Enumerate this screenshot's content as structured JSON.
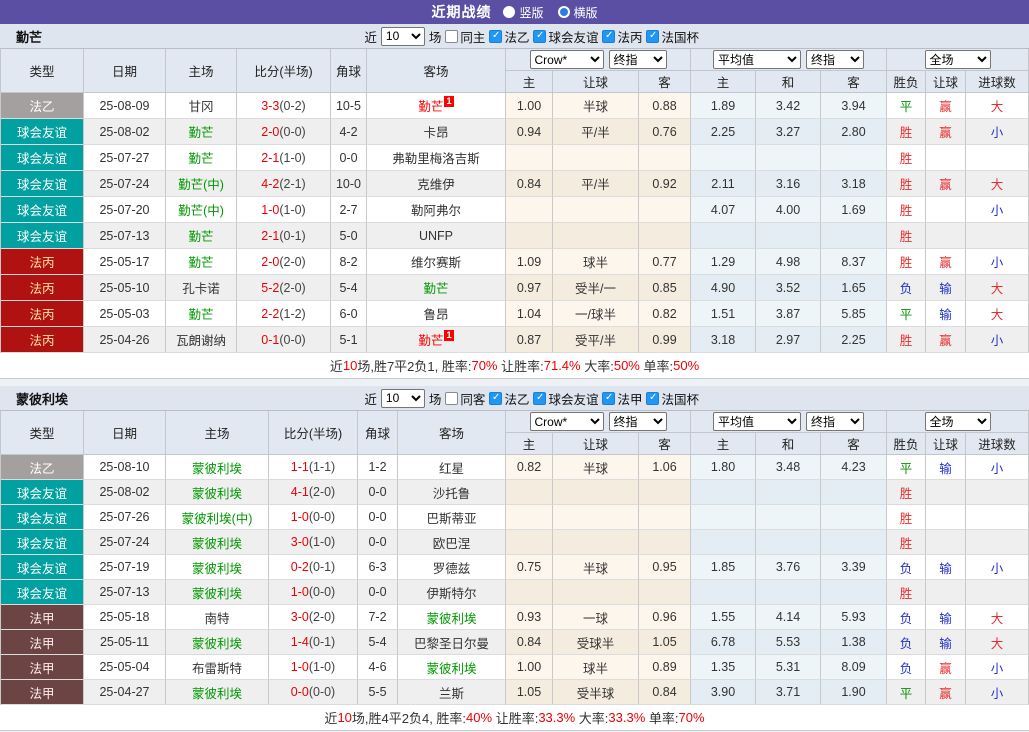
{
  "topbar": {
    "title": "近期战绩",
    "radios": [
      {
        "label": "竖版",
        "checked": false
      },
      {
        "label": "横版",
        "checked": true
      }
    ]
  },
  "left_headers": [
    "类型",
    "日期",
    "主场",
    "比分(半场)",
    "角球",
    "客场"
  ],
  "header_labels": [
    "主",
    "让球",
    "客",
    "主",
    "和",
    "客",
    "胜负",
    "让球",
    "进球数"
  ],
  "dropdowns": {
    "asia": [
      "Crow*",
      "终指"
    ],
    "euro": [
      "平均值",
      "终指"
    ],
    "result": [
      "全场"
    ]
  },
  "colors": {
    "topbar_bg": "#5a4fa2",
    "checkbox_blue": "#2196f3",
    "team_green": "#009900",
    "team_red": "#ff0000",
    "score_red": "#ee0000",
    "win_red": "#e62e2e",
    "lose_blue": "#2330c8",
    "draw_green": "#089000",
    "leagues": {
      "法乙": {
        "bg": "#a5a0a0",
        "fg": "#ffffff"
      },
      "球会友谊": {
        "bg": "#01a1a1",
        "fg": "#ffffff"
      },
      "法丙": {
        "bg": "#b01111",
        "fg": "#ffe3a8"
      },
      "法甲": {
        "bg": "#6d4444",
        "fg": "#ffecec"
      }
    }
  },
  "tables": [
    {
      "team": "勤芒",
      "filter": {
        "prefix": "近",
        "count": "10",
        "suffix": "场",
        "same": {
          "label": "同主",
          "checked": false
        },
        "leagues": [
          {
            "label": "法乙",
            "checked": true
          },
          {
            "label": "球会友谊",
            "checked": true
          },
          {
            "label": "法丙",
            "checked": true
          },
          {
            "label": "法国杯",
            "checked": true
          }
        ]
      },
      "rows": [
        {
          "league": "法乙",
          "date": "25-08-09",
          "home": "甘冈",
          "home_style": "normal",
          "score": "3-3",
          "half": "(0-2)",
          "corner": "10-5",
          "away": "勤芒",
          "away_style": "red",
          "away_badge": "1",
          "asia": [
            "1.00",
            "半球",
            "0.88"
          ],
          "euro": [
            "1.89",
            "3.42",
            "3.94"
          ],
          "result": [
            "平",
            "green"
          ],
          "handicap": [
            "赢",
            "red"
          ],
          "goals": [
            "大",
            "red"
          ]
        },
        {
          "league": "球会友谊",
          "date": "25-08-02",
          "home": "勤芒",
          "home_style": "green",
          "score": "2-0",
          "half": "(0-0)",
          "corner": "4-2",
          "away": "卡昂",
          "away_style": "normal",
          "asia": [
            "0.94",
            "平/半",
            "0.76"
          ],
          "euro": [
            "2.25",
            "3.27",
            "2.80"
          ],
          "result": [
            "胜",
            "red"
          ],
          "handicap": [
            "赢",
            "red"
          ],
          "goals": [
            "小",
            "blue"
          ]
        },
        {
          "league": "球会友谊",
          "date": "25-07-27",
          "home": "勤芒",
          "home_style": "green",
          "score": "2-1",
          "half": "(1-0)",
          "corner": "0-0",
          "away": "弗勒里梅洛吉斯",
          "away_style": "normal",
          "asia": [
            "",
            "",
            ""
          ],
          "euro": [
            "",
            "",
            ""
          ],
          "result": [
            "胜",
            "red"
          ],
          "handicap": [
            "",
            ""
          ],
          "goals": [
            "",
            ""
          ]
        },
        {
          "league": "球会友谊",
          "date": "25-07-24",
          "home": "勤芒(中)",
          "home_style": "green",
          "score": "4-2",
          "half": "(2-1)",
          "corner": "10-0",
          "away": "克维伊",
          "away_style": "normal",
          "asia": [
            "0.84",
            "平/半",
            "0.92"
          ],
          "euro": [
            "2.11",
            "3.16",
            "3.18"
          ],
          "result": [
            "胜",
            "red"
          ],
          "handicap": [
            "赢",
            "red"
          ],
          "goals": [
            "大",
            "red"
          ]
        },
        {
          "league": "球会友谊",
          "date": "25-07-20",
          "home": "勤芒(中)",
          "home_style": "green",
          "score": "1-0",
          "half": "(1-0)",
          "corner": "2-7",
          "away": "勒阿弗尔",
          "away_style": "normal",
          "asia": [
            "",
            "",
            ""
          ],
          "euro": [
            "4.07",
            "4.00",
            "1.69"
          ],
          "result": [
            "胜",
            "red"
          ],
          "handicap": [
            "",
            ""
          ],
          "goals": [
            "小",
            "blue"
          ]
        },
        {
          "league": "球会友谊",
          "date": "25-07-13",
          "home": "勤芒",
          "home_style": "green",
          "score": "2-1",
          "half": "(0-1)",
          "corner": "5-0",
          "away": "UNFP",
          "away_style": "normal",
          "asia": [
            "",
            "",
            ""
          ],
          "euro": [
            "",
            "",
            ""
          ],
          "result": [
            "胜",
            "red"
          ],
          "handicap": [
            "",
            ""
          ],
          "goals": [
            "",
            ""
          ]
        },
        {
          "league": "法丙",
          "date": "25-05-17",
          "home": "勤芒",
          "home_style": "green",
          "score": "2-0",
          "half": "(2-0)",
          "corner": "8-2",
          "away": "维尔赛斯",
          "away_style": "normal",
          "asia": [
            "1.09",
            "球半",
            "0.77"
          ],
          "euro": [
            "1.29",
            "4.98",
            "8.37"
          ],
          "result": [
            "胜",
            "red"
          ],
          "handicap": [
            "赢",
            "red"
          ],
          "goals": [
            "小",
            "blue"
          ]
        },
        {
          "league": "法丙",
          "date": "25-05-10",
          "home": "孔卡诺",
          "home_style": "normal",
          "score": "5-2",
          "half": "(2-0)",
          "corner": "5-4",
          "away": "勤芒",
          "away_style": "green",
          "asia": [
            "0.97",
            "受半/一",
            "0.85"
          ],
          "euro": [
            "4.90",
            "3.52",
            "1.65"
          ],
          "result": [
            "负",
            "blue"
          ],
          "handicap": [
            "输",
            "blue"
          ],
          "goals": [
            "大",
            "red"
          ]
        },
        {
          "league": "法丙",
          "date": "25-05-03",
          "home": "勤芒",
          "home_style": "green",
          "score": "2-2",
          "half": "(1-2)",
          "corner": "6-0",
          "away": "鲁昂",
          "away_style": "normal",
          "asia": [
            "1.04",
            "一/球半",
            "0.82"
          ],
          "euro": [
            "1.51",
            "3.87",
            "5.85"
          ],
          "result": [
            "平",
            "green"
          ],
          "handicap": [
            "输",
            "blue"
          ],
          "goals": [
            "大",
            "red"
          ]
        },
        {
          "league": "法丙",
          "date": "25-04-26",
          "home": "瓦朗谢纳",
          "home_style": "normal",
          "score": "0-1",
          "half": "(0-0)",
          "corner": "5-1",
          "away": "勤芒",
          "away_style": "red",
          "away_badge": "1",
          "asia": [
            "0.87",
            "受平/半",
            "0.99"
          ],
          "euro": [
            "3.18",
            "2.97",
            "2.25"
          ],
          "result": [
            "胜",
            "red"
          ],
          "handicap": [
            "赢",
            "red"
          ],
          "goals": [
            "小",
            "blue"
          ]
        }
      ],
      "summary": [
        {
          "text": "近"
        },
        {
          "text": "10",
          "red": true
        },
        {
          "text": "场,胜7平2负1, 胜率:"
        },
        {
          "text": "70%",
          "red": true
        },
        {
          "text": " 让胜率:"
        },
        {
          "text": "71.4%",
          "red": true
        },
        {
          "text": " 大率:"
        },
        {
          "text": "50%",
          "red": true
        },
        {
          "text": " 单率:"
        },
        {
          "text": "50%",
          "red": true
        }
      ]
    },
    {
      "team": "蒙彼利埃",
      "filter": {
        "prefix": "近",
        "count": "10",
        "suffix": "场",
        "same": {
          "label": "同客",
          "checked": false
        },
        "leagues": [
          {
            "label": "法乙",
            "checked": true
          },
          {
            "label": "球会友谊",
            "checked": true
          },
          {
            "label": "法甲",
            "checked": true
          },
          {
            "label": "法国杯",
            "checked": true
          }
        ]
      },
      "rows": [
        {
          "league": "法乙",
          "date": "25-08-10",
          "home": "蒙彼利埃",
          "home_style": "green",
          "score": "1-1",
          "half": "(1-1)",
          "corner": "1-2",
          "away": "红星",
          "away_style": "normal",
          "asia": [
            "0.82",
            "半球",
            "1.06"
          ],
          "euro": [
            "1.80",
            "3.48",
            "4.23"
          ],
          "result": [
            "平",
            "green"
          ],
          "handicap": [
            "输",
            "blue"
          ],
          "goals": [
            "小",
            "blue"
          ]
        },
        {
          "league": "球会友谊",
          "date": "25-08-02",
          "home": "蒙彼利埃",
          "home_style": "green",
          "score": "4-1",
          "half": "(2-0)",
          "corner": "0-0",
          "away": "沙托鲁",
          "away_style": "normal",
          "asia": [
            "",
            "",
            ""
          ],
          "euro": [
            "",
            "",
            ""
          ],
          "result": [
            "胜",
            "red"
          ],
          "handicap": [
            "",
            ""
          ],
          "goals": [
            "",
            ""
          ]
        },
        {
          "league": "球会友谊",
          "date": "25-07-26",
          "home": "蒙彼利埃(中)",
          "home_style": "green",
          "score": "1-0",
          "half": "(0-0)",
          "corner": "0-0",
          "away": "巴斯蒂亚",
          "away_style": "normal",
          "asia": [
            "",
            "",
            ""
          ],
          "euro": [
            "",
            "",
            ""
          ],
          "result": [
            "胜",
            "red"
          ],
          "handicap": [
            "",
            ""
          ],
          "goals": [
            "",
            ""
          ]
        },
        {
          "league": "球会友谊",
          "date": "25-07-24",
          "home": "蒙彼利埃",
          "home_style": "green",
          "score": "3-0",
          "half": "(1-0)",
          "corner": "0-0",
          "away": "欧巴涅",
          "away_style": "normal",
          "asia": [
            "",
            "",
            ""
          ],
          "euro": [
            "",
            "",
            ""
          ],
          "result": [
            "胜",
            "red"
          ],
          "handicap": [
            "",
            ""
          ],
          "goals": [
            "",
            ""
          ]
        },
        {
          "league": "球会友谊",
          "date": "25-07-19",
          "home": "蒙彼利埃",
          "home_style": "green",
          "score": "0-2",
          "half": "(0-1)",
          "corner": "6-3",
          "away": "罗德兹",
          "away_style": "normal",
          "asia": [
            "0.75",
            "半球",
            "0.95"
          ],
          "euro": [
            "1.85",
            "3.76",
            "3.39"
          ],
          "result": [
            "负",
            "blue"
          ],
          "handicap": [
            "输",
            "blue"
          ],
          "goals": [
            "小",
            "blue"
          ]
        },
        {
          "league": "球会友谊",
          "date": "25-07-13",
          "home": "蒙彼利埃",
          "home_style": "green",
          "score": "1-0",
          "half": "(0-0)",
          "corner": "0-0",
          "away": "伊斯特尔",
          "away_style": "normal",
          "asia": [
            "",
            "",
            ""
          ],
          "euro": [
            "",
            "",
            ""
          ],
          "result": [
            "胜",
            "red"
          ],
          "handicap": [
            "",
            ""
          ],
          "goals": [
            "",
            ""
          ]
        },
        {
          "league": "法甲",
          "date": "25-05-18",
          "home": "南特",
          "home_style": "normal",
          "score": "3-0",
          "half": "(2-0)",
          "corner": "7-2",
          "away": "蒙彼利埃",
          "away_style": "green",
          "asia": [
            "0.93",
            "一球",
            "0.96"
          ],
          "euro": [
            "1.55",
            "4.14",
            "5.93"
          ],
          "result": [
            "负",
            "blue"
          ],
          "handicap": [
            "输",
            "blue"
          ],
          "goals": [
            "大",
            "red"
          ]
        },
        {
          "league": "法甲",
          "date": "25-05-11",
          "home": "蒙彼利埃",
          "home_style": "green",
          "score": "1-4",
          "half": "(0-1)",
          "corner": "5-4",
          "away": "巴黎圣日尔曼",
          "away_style": "normal",
          "asia": [
            "0.84",
            "受球半",
            "1.05"
          ],
          "euro": [
            "6.78",
            "5.53",
            "1.38"
          ],
          "result": [
            "负",
            "blue"
          ],
          "handicap": [
            "输",
            "blue"
          ],
          "goals": [
            "大",
            "red"
          ]
        },
        {
          "league": "法甲",
          "date": "25-05-04",
          "home": "布雷斯特",
          "home_style": "normal",
          "score": "1-0",
          "half": "(1-0)",
          "corner": "4-6",
          "away": "蒙彼利埃",
          "away_style": "green",
          "asia": [
            "1.00",
            "球半",
            "0.89"
          ],
          "euro": [
            "1.35",
            "5.31",
            "8.09"
          ],
          "result": [
            "负",
            "blue"
          ],
          "handicap": [
            "赢",
            "red"
          ],
          "goals": [
            "小",
            "blue"
          ]
        },
        {
          "league": "法甲",
          "date": "25-04-27",
          "home": "蒙彼利埃",
          "home_style": "green",
          "score": "0-0",
          "half": "(0-0)",
          "corner": "5-5",
          "away": "兰斯",
          "away_style": "normal",
          "asia": [
            "1.05",
            "受半球",
            "0.84"
          ],
          "euro": [
            "3.90",
            "3.71",
            "1.90"
          ],
          "result": [
            "平",
            "green"
          ],
          "handicap": [
            "赢",
            "red"
          ],
          "goals": [
            "小",
            "blue"
          ]
        }
      ],
      "summary": [
        {
          "text": "近"
        },
        {
          "text": "10",
          "red": true
        },
        {
          "text": "场,胜4平2负4, 胜率:"
        },
        {
          "text": "40%",
          "red": true
        },
        {
          "text": " 让胜率:"
        },
        {
          "text": "33.3%",
          "red": true
        },
        {
          "text": " 大率:"
        },
        {
          "text": "33.3%",
          "red": true
        },
        {
          "text": " 单率:"
        },
        {
          "text": "70%",
          "red": true
        }
      ]
    }
  ]
}
